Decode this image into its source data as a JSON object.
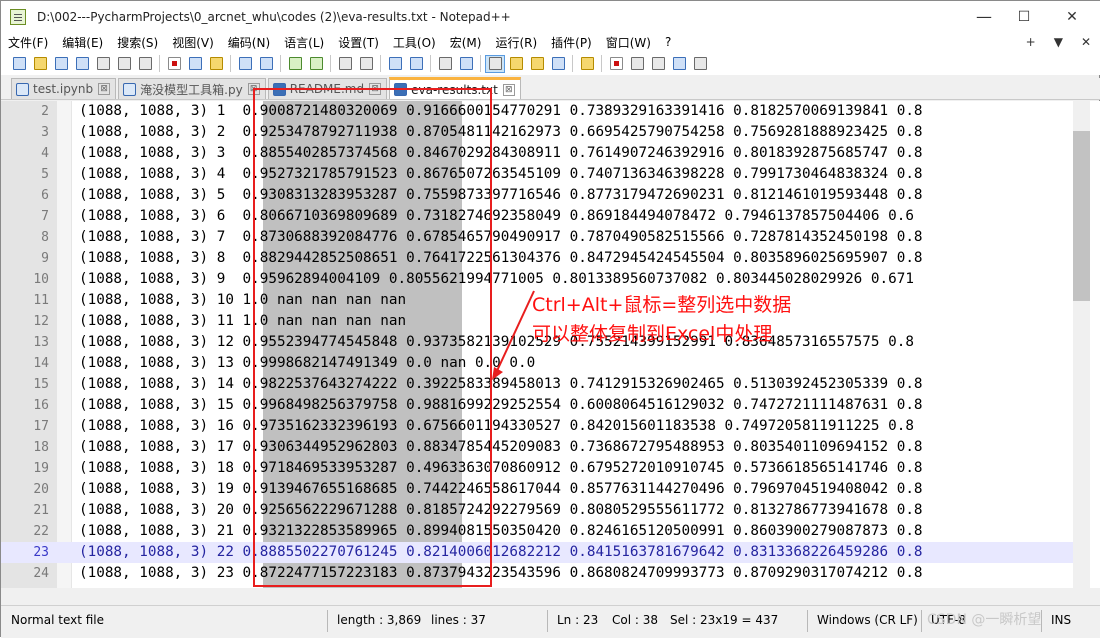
{
  "window": {
    "title": "D:\\002---PycharmProjects\\0_arcnet_whu\\codes (2)\\eva-results.txt - Notepad++",
    "minimize": "—",
    "maximize": "☐",
    "close": "✕"
  },
  "menu": {
    "items": [
      "文件(F)",
      "编辑(E)",
      "搜索(S)",
      "视图(V)",
      "编码(N)",
      "语言(L)",
      "设置(T)",
      "工具(O)",
      "宏(M)",
      "运行(R)",
      "插件(P)",
      "窗口(W)",
      "?"
    ],
    "right": [
      "+",
      "▼",
      "✕"
    ]
  },
  "toolbar": {
    "icons": [
      "new-file-icon",
      "open-file-icon",
      "save-icon",
      "save-all-icon",
      "close-icon",
      "close-all-icon",
      "print-icon",
      "cut-icon",
      "copy-icon",
      "paste-icon",
      "undo-icon",
      "redo-icon",
      "find-icon",
      "replace-icon",
      "zoom-in-icon",
      "zoom-out-icon",
      "sync-v-icon",
      "sync-h-icon",
      "word-wrap-icon",
      "show-all-chars-icon",
      "indent-guide-icon",
      "doc-map-icon",
      "function-list-icon",
      "folder-workspace-icon",
      "monitoring-icon",
      "record-macro-icon",
      "stop-macro-icon",
      "play-macro-icon",
      "run-macro-multiple-icon",
      "save-macro-icon"
    ]
  },
  "tabs": [
    {
      "label": "test.ipynb",
      "active": false,
      "close": "⊠"
    },
    {
      "label": "淹没模型工具箱.py",
      "active": false,
      "close": "⊠"
    },
    {
      "label": "README.md",
      "active": false,
      "close": "⊠"
    },
    {
      "label": "eva-results.txt",
      "active": true,
      "close": "⊠"
    }
  ],
  "editor": {
    "current_line": 23,
    "lines": [
      {
        "num": "2",
        "text": "(1088, 1088, 3) 1  0.9008721480320069 0.9166600154770291 0.7389329163391416 0.8182570069139841 0.8"
      },
      {
        "num": "3",
        "text": "(1088, 1088, 3) 2  0.9253478792711938 0.8705481142162973 0.6695425790754258 0.7569281888923425 0.8"
      },
      {
        "num": "4",
        "text": "(1088, 1088, 3) 3  0.8855402857374568 0.8467029284308911 0.7614907246392916 0.8018392875685747 0.8"
      },
      {
        "num": "5",
        "text": "(1088, 1088, 3) 4  0.9527321785791523 0.8676507263545109 0.7407136346398228 0.7991730464838324 0.8"
      },
      {
        "num": "6",
        "text": "(1088, 1088, 3) 5  0.9308313283953287 0.7559873397716546 0.8773179472690231 0.8121461019593448 0.8"
      },
      {
        "num": "7",
        "text": "(1088, 1088, 3) 6  0.8066710369809689 0.7318274692358049 0.869184494078472 0.7946137857504406 0.6"
      },
      {
        "num": "8",
        "text": "(1088, 1088, 3) 7  0.8730688392084776 0.6785465790490917 0.7870490582515566 0.7287814352450198 0.8"
      },
      {
        "num": "9",
        "text": "(1088, 1088, 3) 8  0.8829442852508651 0.7641722561304376 0.8472945424545504 0.8035896025695907 0.8"
      },
      {
        "num": "10",
        "text": "(1088, 1088, 3) 9  0.95962894004109 0.8055621994771005 0.8013389560737082 0.803445028029926 0.671"
      },
      {
        "num": "11",
        "text": "(1088, 1088, 3) 10 1.0 nan nan nan nan"
      },
      {
        "num": "12",
        "text": "(1088, 1088, 3) 11 1.0 nan nan nan nan"
      },
      {
        "num": "13",
        "text": "(1088, 1088, 3) 12 0.9552394774545848 0.9373582139102529 0.755214399152991 0.8364857316557575 0.8"
      },
      {
        "num": "14",
        "text": "(1088, 1088, 3) 13 0.9998682147491349 0.0 nan 0.0 0.0"
      },
      {
        "num": "15",
        "text": "(1088, 1088, 3) 14 0.9822537643274222 0.3922583389458013 0.7412915326902465 0.5130392452305339 0.8"
      },
      {
        "num": "16",
        "text": "(1088, 1088, 3) 15 0.9968498256379758 0.9881699229252554 0.6008064516129032 0.7472721111487631 0.8"
      },
      {
        "num": "17",
        "text": "(1088, 1088, 3) 16 0.9735162332396193 0.6756601194330527 0.842015601183538 0.7497205811911225 0.8"
      },
      {
        "num": "18",
        "text": "(1088, 1088, 3) 17 0.9306344952962803 0.8834785445209083 0.7368672795488953 0.8035401109694152 0.8"
      },
      {
        "num": "19",
        "text": "(1088, 1088, 3) 18 0.9718469533953287 0.4963363070860912 0.6795272010910745 0.5736618565141746 0.8"
      },
      {
        "num": "20",
        "text": "(1088, 1088, 3) 19 0.9139467655168685 0.7442246558617044 0.8577631144270496 0.7969704519408042 0.8"
      },
      {
        "num": "21",
        "text": "(1088, 1088, 3) 20 0.9256562229671288 0.8185724292279569 0.8080529555611772 0.8132786773941678 0.8"
      },
      {
        "num": "22",
        "text": "(1088, 1088, 3) 21 0.9321322853589965 0.8994081550350420 0.8246165120500991 0.8603900279087873 0.8"
      },
      {
        "num": "23",
        "text": "(1088, 1088, 3) 22 0.8885502270761245 0.8214006012682212 0.8415163781679642 0.8313368226459286 0.8"
      },
      {
        "num": "24",
        "text": "(1088, 1088, 3) 23 0.8722477157223183 0.8737943223543596 0.8680824709993773 0.8709290317074212 0.8"
      }
    ]
  },
  "annotation": {
    "line1": "Ctrl+Alt+鼠标=整列选中数据",
    "line2": "可以整体复制到Excel中处理",
    "color": "#ff1010"
  },
  "status": {
    "file_type": "Normal text file",
    "length": "length : 3,869",
    "lines": "lines : 37",
    "ln": "Ln : 23",
    "col": "Col : 38",
    "sel": "Sel : 23x19 = 437",
    "eol": "Windows (CR LF)",
    "encoding": "UTF-8",
    "ins": "INS"
  },
  "watermark": "CSDN @一瞬析望",
  "colors": {
    "selection": "#c0c0c0",
    "current_line": "#e8e8ff",
    "active_tab_accent": "#fab340",
    "annotation_box": "#e81e1e"
  }
}
